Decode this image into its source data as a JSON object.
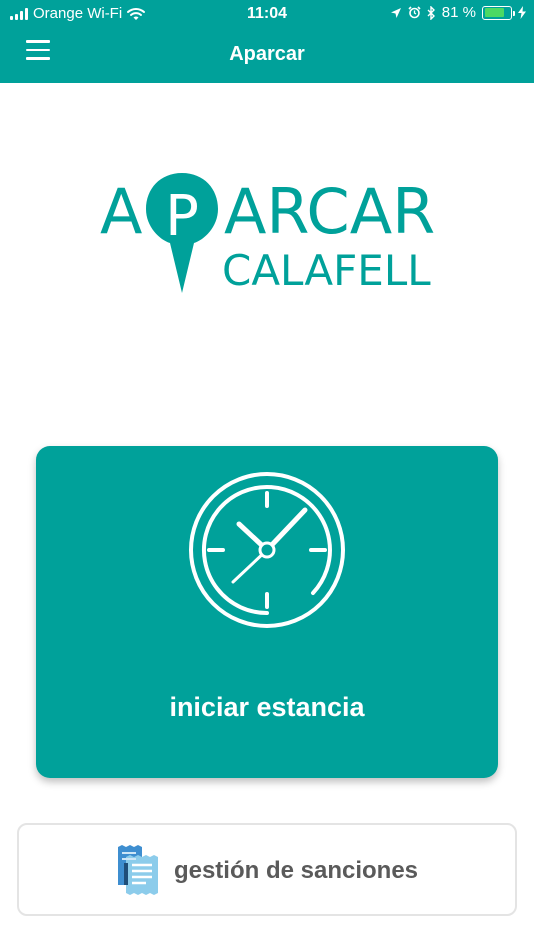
{
  "status_bar": {
    "carrier": "Orange Wi-Fi",
    "time": "11:04",
    "battery_percent": "81 %",
    "battery_level": 0.81
  },
  "nav": {
    "title": "Aparcar"
  },
  "logo": {
    "line1": "APARCAR",
    "line2": "CALAFELL"
  },
  "start_card": {
    "label": "iniciar estancia"
  },
  "sanctions_card": {
    "label": "gestión de sanciones"
  },
  "colors": {
    "brand": "#00A19A",
    "battery": "#4CD964",
    "secondary_text": "#5a5a5a"
  }
}
